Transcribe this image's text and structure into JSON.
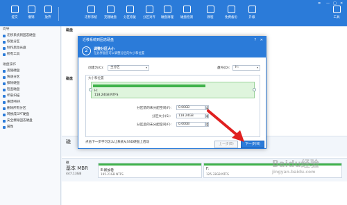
{
  "toolbar": {
    "buttons": [
      {
        "label": "提交",
        "icon": "check-icon"
      },
      {
        "label": "撤销",
        "icon": "undo-icon"
      },
      {
        "label": "放弃",
        "icon": "discard-icon"
      },
      {
        "label": "迁移系统",
        "icon": "migrate-os-icon"
      },
      {
        "label": "克隆磁盘",
        "icon": "clone-disk-icon"
      },
      {
        "label": "分区恢复",
        "icon": "partition-recovery-icon"
      },
      {
        "label": "分区对齐",
        "icon": "align-icon"
      },
      {
        "label": "磁盘清理",
        "icon": "wipe-icon"
      },
      {
        "label": "磁盘检测",
        "icon": "disk-test-icon"
      },
      {
        "label": "教程",
        "icon": "tutorial-icon"
      },
      {
        "label": "免费备份",
        "icon": "backup-icon"
      },
      {
        "label": "升级",
        "icon": "upgrade-icon"
      },
      {
        "label": "工具",
        "icon": "tools-icon"
      }
    ]
  },
  "sidebar": {
    "wizard_head": "向导",
    "wizard_items": [
      "迁移系统到固态硬盘",
      "恢复分区",
      "制作启动光盘",
      "所有工具"
    ],
    "disk_head": "磁盘操作",
    "disk_items": [
      "克隆硬盘",
      "快速分区",
      "擦除硬盘",
      "检查磁盘",
      "坏扇扫描",
      "重建MBR",
      "删除所有分区",
      "转换成GPT硬盘",
      "安全擦除固态硬盘",
      "属性"
    ]
  },
  "main": {
    "disk1_label": "磁盘",
    "disk2_label": "磁盘",
    "disk_a": {
      "name": "磁",
      "size": ""
    },
    "disk_b": {
      "name": "基本 MBR",
      "size": "447.13GB",
      "id": "磁"
    },
    "part_e": {
      "name": "E:新加卷",
      "info": "195.21GB NTFS"
    },
    "part_f": {
      "name": "F:",
      "info": "125.33GB NTFS"
    }
  },
  "dialog": {
    "title": "迁移系统到固态硬盘",
    "help": "?",
    "close": "✕",
    "step_num": "2",
    "step_title": "调整分区大小",
    "step_desc": "在此界面您可以调整分区的大小和位置",
    "create_as_label": "创建为(C):",
    "create_as_value": "主分区",
    "drive_letter_label": "盘符(D):",
    "drive_letter_value": "H:",
    "size_group_title": "大小和位置",
    "part_letter": "H:",
    "part_info": "118.24GB NTFS",
    "before_label": "分区前的未分配空间(F):",
    "before_value": "0.00GB",
    "size_label": "分区大小(S):",
    "size_value": "118.24GB",
    "after_label": "分区后的未分配空间(F):",
    "after_value": "0.00GB",
    "hint": "点击下一步学习怎么让系统从SSD硬盘上启动",
    "prev_button": "上一步(B)",
    "next_button": "下一步(N)"
  },
  "watermark": {
    "text": "Baidu经验",
    "sub": "jingyan.baidu.com"
  },
  "colors": {
    "accent": "#2b7bd9",
    "partition_green": "#3fb24a",
    "annotation_red": "#e02020"
  }
}
